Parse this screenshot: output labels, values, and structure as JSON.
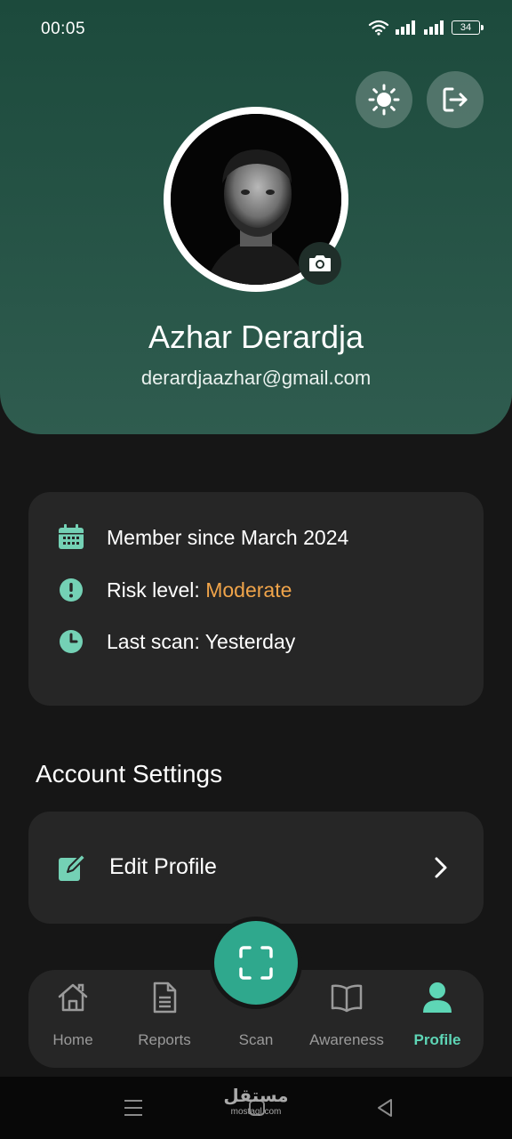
{
  "status_bar": {
    "time": "00:05",
    "battery": "34"
  },
  "profile": {
    "name": "Azhar Derardja",
    "email": "derardjaazhar@gmail.com",
    "theme_icon": "sun-icon",
    "logout_icon": "logout-icon",
    "camera_icon": "camera-icon"
  },
  "info": {
    "member_since": "Member since March 2024",
    "risk_label": "Risk level: ",
    "risk_value": "Moderate",
    "last_scan": "Last scan: Yesterday",
    "accent_color": "#74d1b5",
    "risk_color": "#f0a44a"
  },
  "settings": {
    "title": "Account Settings",
    "edit_profile": "Edit Profile"
  },
  "nav": {
    "items": [
      {
        "label": "Home",
        "icon": "home-icon"
      },
      {
        "label": "Reports",
        "icon": "document-icon"
      },
      {
        "label": "Scan",
        "icon": "scan-icon"
      },
      {
        "label": "Awareness",
        "icon": "book-icon"
      },
      {
        "label": "Profile",
        "icon": "person-icon",
        "active": true
      }
    ],
    "active_color": "#5ed6b6"
  },
  "watermark": {
    "arabic": "مستقل",
    "latin": "mostaql.com"
  }
}
